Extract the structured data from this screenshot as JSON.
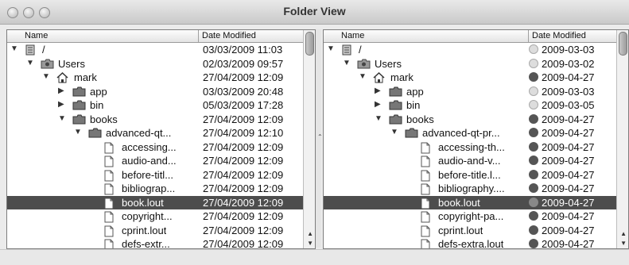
{
  "window": {
    "title": "Folder View"
  },
  "left": {
    "headers": {
      "name": "Name",
      "date": "Date Modified"
    },
    "rows": [
      {
        "name": "/",
        "date": "03/03/2009 11:03",
        "level": 0,
        "type": "drive",
        "expanded": true
      },
      {
        "name": "Users",
        "date": "02/03/2009 09:57",
        "level": 1,
        "type": "users",
        "expanded": true
      },
      {
        "name": "mark",
        "date": "27/04/2009 12:09",
        "level": 2,
        "type": "home",
        "expanded": true
      },
      {
        "name": "app",
        "date": "03/03/2009 20:48",
        "level": 3,
        "type": "folder",
        "expanded": false
      },
      {
        "name": "bin",
        "date": "05/03/2009 17:28",
        "level": 3,
        "type": "folder",
        "expanded": false
      },
      {
        "name": "books",
        "date": "27/04/2009 12:09",
        "level": 3,
        "type": "folder",
        "expanded": true
      },
      {
        "name": "advanced-qt...",
        "date": "27/04/2009 12:10",
        "level": 4,
        "type": "folder",
        "expanded": true
      },
      {
        "name": "accessing...",
        "date": "27/04/2009 12:09",
        "level": 5,
        "type": "file"
      },
      {
        "name": "audio-and...",
        "date": "27/04/2009 12:09",
        "level": 5,
        "type": "file"
      },
      {
        "name": "before-titl...",
        "date": "27/04/2009 12:09",
        "level": 5,
        "type": "file"
      },
      {
        "name": "bibliograp...",
        "date": "27/04/2009 12:09",
        "level": 5,
        "type": "file"
      },
      {
        "name": "book.lout",
        "date": "27/04/2009 12:09",
        "level": 5,
        "type": "file",
        "selected": true
      },
      {
        "name": "copyright...",
        "date": "27/04/2009 12:09",
        "level": 5,
        "type": "file"
      },
      {
        "name": "cprint.lout",
        "date": "27/04/2009 12:09",
        "level": 5,
        "type": "file"
      },
      {
        "name": "defs-extr...",
        "date": "27/04/2009 12:09",
        "level": 5,
        "type": "file"
      }
    ]
  },
  "right": {
    "headers": {
      "name": "Name",
      "date": "Date Modified"
    },
    "rows": [
      {
        "name": "/",
        "date": "2009-03-03",
        "level": 0,
        "type": "drive",
        "expanded": true,
        "clock": "light"
      },
      {
        "name": "Users",
        "date": "2009-03-02",
        "level": 1,
        "type": "users",
        "expanded": true,
        "clock": "light"
      },
      {
        "name": "mark",
        "date": "2009-04-27",
        "level": 2,
        "type": "home",
        "expanded": true,
        "clock": "dark"
      },
      {
        "name": "app",
        "date": "2009-03-03",
        "level": 3,
        "type": "folder",
        "expanded": false,
        "clock": "light"
      },
      {
        "name": "bin",
        "date": "2009-03-05",
        "level": 3,
        "type": "folder",
        "expanded": false,
        "clock": "light"
      },
      {
        "name": "books",
        "date": "2009-04-27",
        "level": 3,
        "type": "folder",
        "expanded": true,
        "clock": "dark"
      },
      {
        "name": "advanced-qt-pr...",
        "date": "2009-04-27",
        "level": 4,
        "type": "folder",
        "expanded": true,
        "clock": "dark"
      },
      {
        "name": "accessing-th...",
        "date": "2009-04-27",
        "level": 5,
        "type": "file",
        "clock": "dark"
      },
      {
        "name": "audio-and-v...",
        "date": "2009-04-27",
        "level": 5,
        "type": "file",
        "clock": "dark"
      },
      {
        "name": "before-title.l...",
        "date": "2009-04-27",
        "level": 5,
        "type": "file",
        "clock": "dark"
      },
      {
        "name": "bibliography....",
        "date": "2009-04-27",
        "level": 5,
        "type": "file",
        "clock": "dark"
      },
      {
        "name": "book.lout",
        "date": "2009-04-27",
        "level": 5,
        "type": "file",
        "selected": true,
        "clock": "dark"
      },
      {
        "name": "copyright-pa...",
        "date": "2009-04-27",
        "level": 5,
        "type": "file",
        "clock": "dark"
      },
      {
        "name": "cprint.lout",
        "date": "2009-04-27",
        "level": 5,
        "type": "file",
        "clock": "dark"
      },
      {
        "name": "defs-extra.lout",
        "date": "2009-04-27",
        "level": 5,
        "type": "file",
        "clock": "dark"
      }
    ]
  },
  "icons": {
    "expanded": "triangle-down-icon",
    "collapsed": "triangle-right-icon",
    "folder": "folder-icon",
    "file": "document-icon",
    "home": "home-icon",
    "drive": "hard-drive-icon",
    "users": "users-folder-icon",
    "clock": "clock-icon"
  },
  "colors": {
    "selection": "#4d4d4d",
    "background": "#ffffff"
  }
}
